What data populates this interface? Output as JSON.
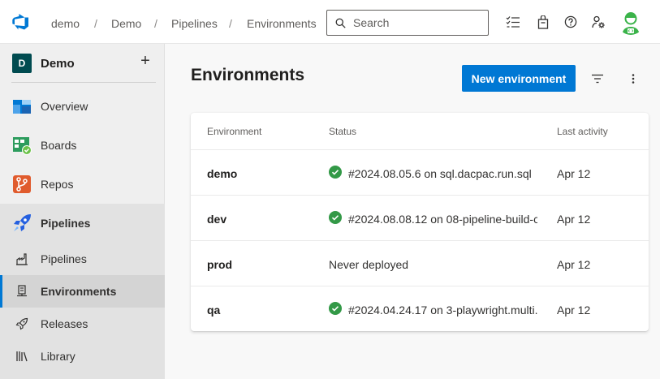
{
  "header": {
    "breadcrumb": [
      "demo",
      "Demo",
      "Pipelines",
      "Environments"
    ],
    "separator": "/",
    "search": {
      "placeholder": "Search"
    },
    "icons": [
      "task-list-icon",
      "shopping-bag-icon",
      "help-icon",
      "user-settings-icon"
    ]
  },
  "sidebar": {
    "project": {
      "initial": "D",
      "name": "Demo",
      "add_symbol": "+"
    },
    "items": [
      {
        "label": "Overview",
        "icon": "overview-icon"
      },
      {
        "label": "Boards",
        "icon": "boards-icon"
      },
      {
        "label": "Repos",
        "icon": "repos-icon"
      },
      {
        "label": "Pipelines",
        "icon": "pipelines-icon"
      }
    ],
    "subitems": [
      {
        "label": "Pipelines",
        "icon": "pipelines-sub-icon"
      },
      {
        "label": "Environments",
        "icon": "environments-icon",
        "selected": true
      },
      {
        "label": "Releases",
        "icon": "releases-icon"
      },
      {
        "label": "Library",
        "icon": "library-icon"
      }
    ]
  },
  "main": {
    "title": "Environments",
    "new_button": "New environment",
    "table": {
      "columns": [
        "Environment",
        "Status",
        "Last activity"
      ],
      "rows": [
        {
          "name": "demo",
          "status": "#2024.08.05.6 on sql.dacpac.run.sql",
          "succeeded": true,
          "last": "Apr 12"
        },
        {
          "name": "dev",
          "status": "#2024.08.08.12 on 08-pipeline-build-c",
          "succeeded": true,
          "last": "Apr 12"
        },
        {
          "name": "prod",
          "status": "Never deployed",
          "succeeded": false,
          "last": "Apr 12"
        },
        {
          "name": "qa",
          "status": "#2024.04.24.17 on 3-playwright.multi.",
          "succeeded": true,
          "last": "Apr 12"
        }
      ]
    }
  },
  "colors": {
    "accent": "#0078d4",
    "success": "#339947",
    "project_avatar": "#004b50"
  }
}
